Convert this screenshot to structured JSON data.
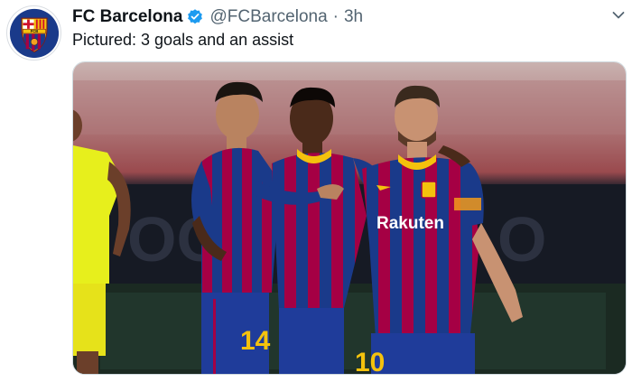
{
  "account": {
    "display_name": "FC Barcelona",
    "handle": "@FCBarcelona",
    "separator": "·",
    "timestamp": "3h",
    "verified": true,
    "avatar_icon": "fc-barcelona-crest-icon",
    "avatar_text": "FCB"
  },
  "tweet": {
    "text": "Pictured: 3 goals and an assist"
  },
  "media": {
    "kind": "photo",
    "sponsor_text": "Rakuten",
    "shirt_numbers": [
      "14",
      "10"
    ]
  },
  "colors": {
    "verified_blue": "#1d9bf0",
    "barca_blue": "#1a3a8a",
    "barca_red": "#a50044",
    "gold": "#f4c20d",
    "secondary_text": "#536471"
  }
}
